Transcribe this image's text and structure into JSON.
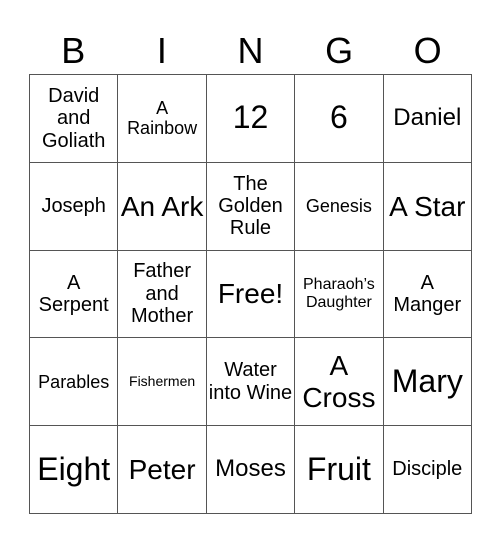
{
  "header": [
    "B",
    "I",
    "N",
    "G",
    "O"
  ],
  "cells": [
    "David and Goliath",
    "A Rainbow",
    "12",
    "6",
    "Daniel",
    "Joseph",
    "An Ark",
    "The Golden Rule",
    "Genesis",
    "A Star",
    "A Serpent",
    "Father and Mother",
    "Free!",
    "Pharaoh’s Daughter",
    "A Manger",
    "Parables",
    "Fishermen",
    "Water into Wine",
    "A Cross",
    "Mary",
    "Eight",
    "Peter",
    "Moses",
    "Fruit",
    "Disciple"
  ]
}
